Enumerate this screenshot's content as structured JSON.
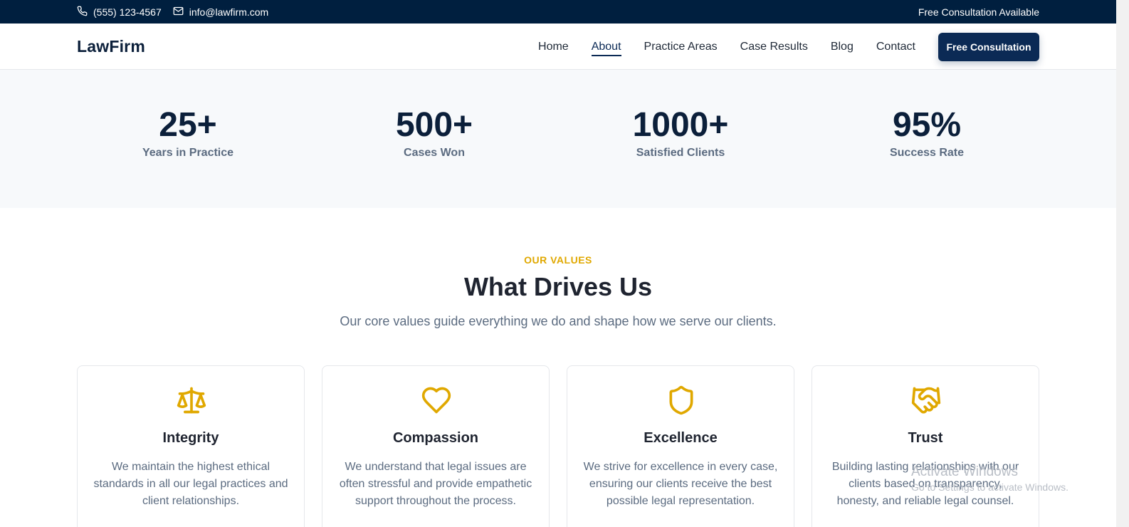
{
  "topbar": {
    "phone": "(555) 123-4567",
    "email": "info@lawfirm.com",
    "notice": "Free Consultation Available"
  },
  "header": {
    "logo": "LawFirm",
    "nav": [
      "Home",
      "About",
      "Practice Areas",
      "Case Results",
      "Blog",
      "Contact"
    ],
    "active_nav": "About",
    "cta_label": "Free Consultation"
  },
  "stats": [
    {
      "value": "25+",
      "label": "Years in Practice"
    },
    {
      "value": "500+",
      "label": "Cases Won"
    },
    {
      "value": "1000+",
      "label": "Satisfied Clients"
    },
    {
      "value": "95%",
      "label": "Success Rate"
    }
  ],
  "values_section": {
    "eyebrow": "OUR VALUES",
    "title": "What Drives Us",
    "subtitle": "Our core values guide everything we do and shape how we serve our clients.",
    "cards": [
      {
        "icon": "scale-icon",
        "title": "Integrity",
        "description": "We maintain the highest ethical standards in all our legal practices and client relationships."
      },
      {
        "icon": "heart-icon",
        "title": "Compassion",
        "description": "We understand that legal issues are often stressful and provide empathetic support throughout the process."
      },
      {
        "icon": "shield-icon",
        "title": "Excellence",
        "description": "We strive for excellence in every case, ensuring our clients receive the best possible legal representation."
      },
      {
        "icon": "handshake-icon",
        "title": "Trust",
        "description": "Building lasting relationships with our clients based on transparency, honesty, and reliable legal counsel."
      }
    ]
  },
  "watermark": {
    "line1": "Activate Windows",
    "line2": "Go to Settings to activate Windows."
  },
  "colors": {
    "navy": "#001f3f",
    "primary": "#0b2a55",
    "accent": "#e0a800",
    "muted": "#5b6b80"
  }
}
